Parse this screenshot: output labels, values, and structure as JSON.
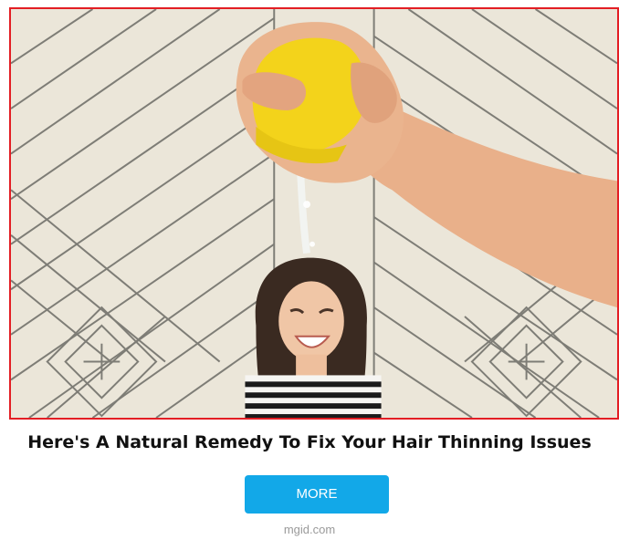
{
  "ad": {
    "headline": "Here's A Natural Remedy To Fix Your Hair Thinning Issues",
    "cta_label": "MORE",
    "source": "mgid.com",
    "image_icon": "ad-photo-image"
  },
  "colors": {
    "frame_border": "#e31e24",
    "cta_background": "#12a8e8",
    "cta_text": "#ffffff",
    "headline_text": "#111111",
    "source_text": "#9a9a9a"
  }
}
